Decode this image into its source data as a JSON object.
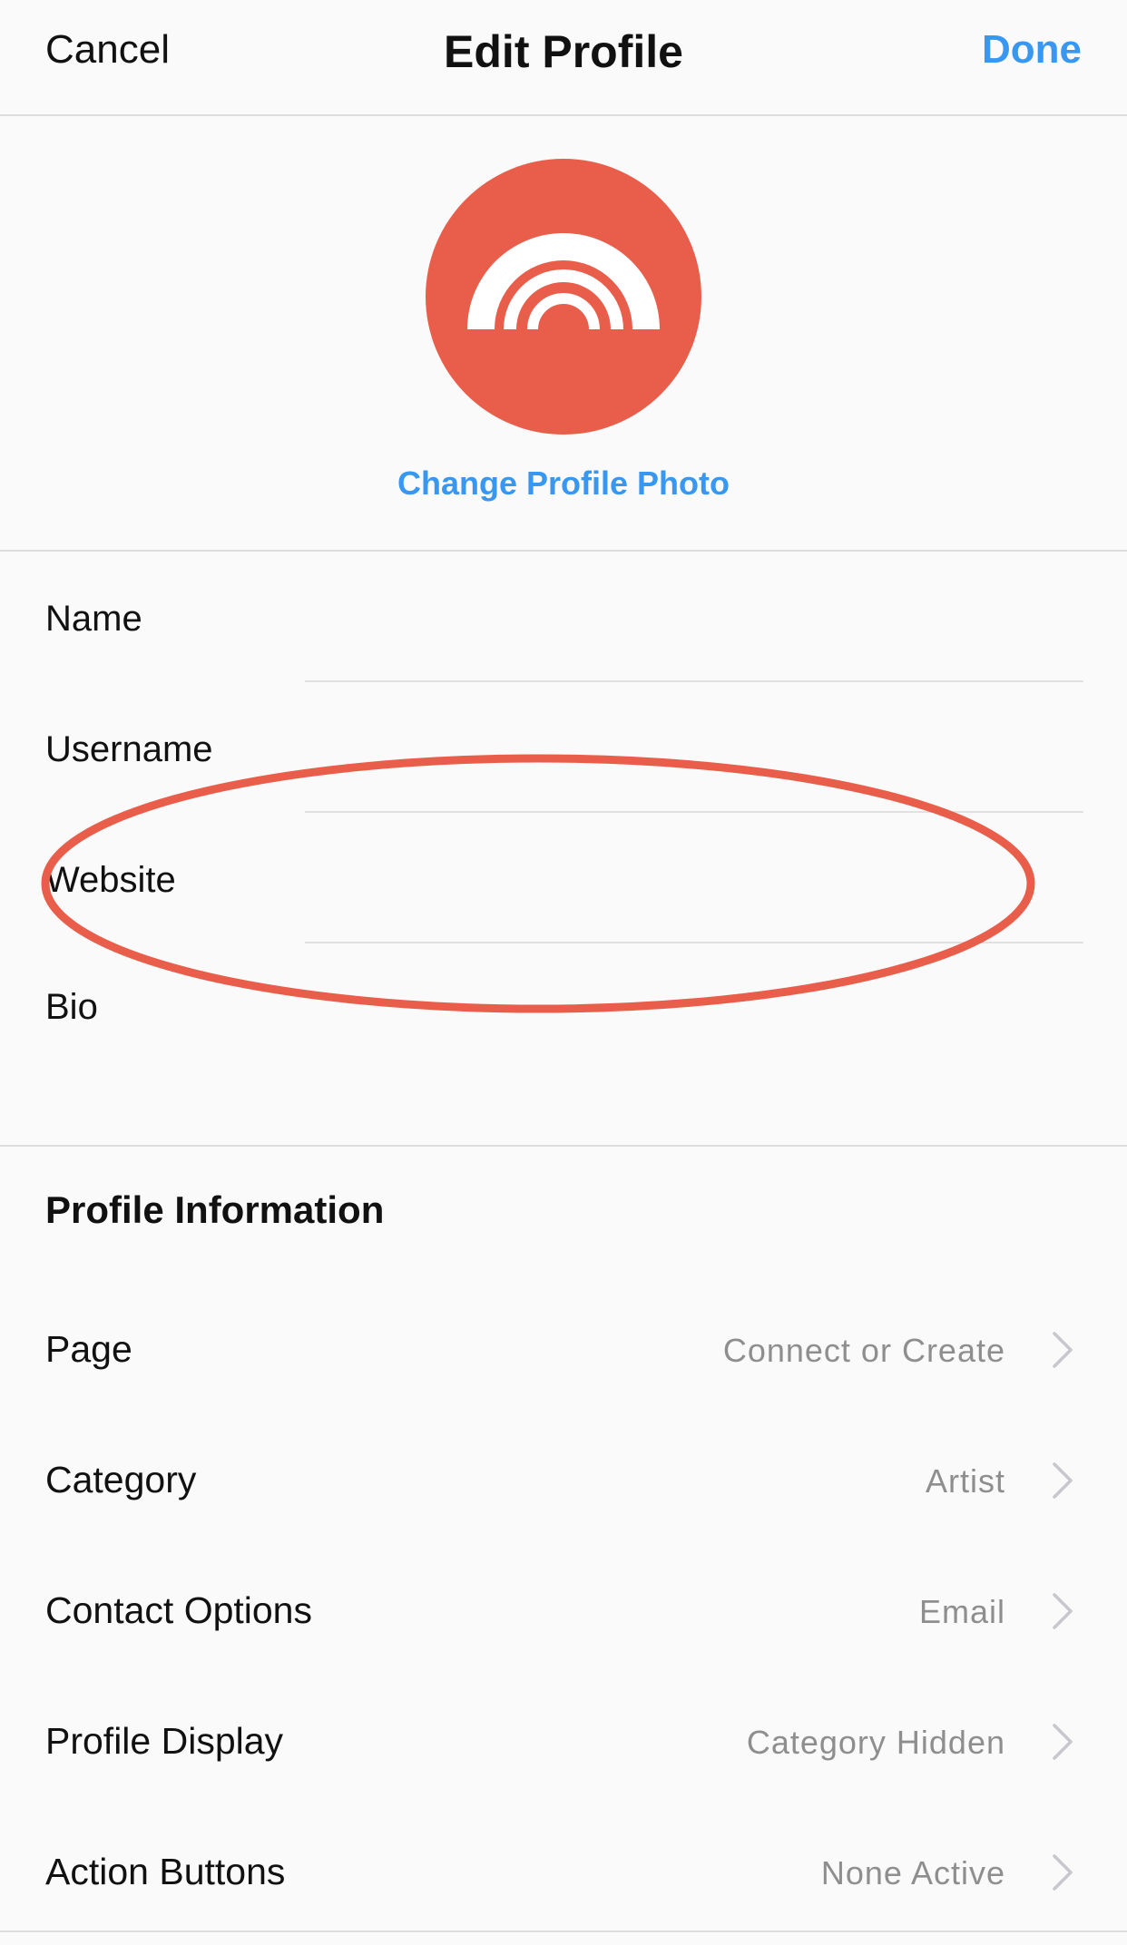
{
  "nav": {
    "cancel_label": "Cancel",
    "title": "Edit Profile",
    "done_label": "Done"
  },
  "profile_photo": {
    "icon": "rainbow-logo-icon",
    "change_label": "Change Profile Photo"
  },
  "fields": [
    {
      "label": "Name",
      "value": ""
    },
    {
      "label": "Username",
      "value": ""
    },
    {
      "label": "Website",
      "value": ""
    },
    {
      "label": "Bio",
      "value": ""
    }
  ],
  "profile_information": {
    "header": "Profile Information",
    "rows": [
      {
        "label": "Page",
        "value": "Connect or Create"
      },
      {
        "label": "Category",
        "value": "Artist"
      },
      {
        "label": "Contact Options",
        "value": "Email"
      },
      {
        "label": "Profile Display",
        "value": "Category Hidden"
      },
      {
        "label": "Action Buttons",
        "value": "None Active"
      }
    ]
  },
  "colors": {
    "accent_blue": "#3897f0",
    "avatar_red": "#e95e4a",
    "annotation_red": "#e95e4a",
    "secondary_text": "#8e8e8e"
  }
}
